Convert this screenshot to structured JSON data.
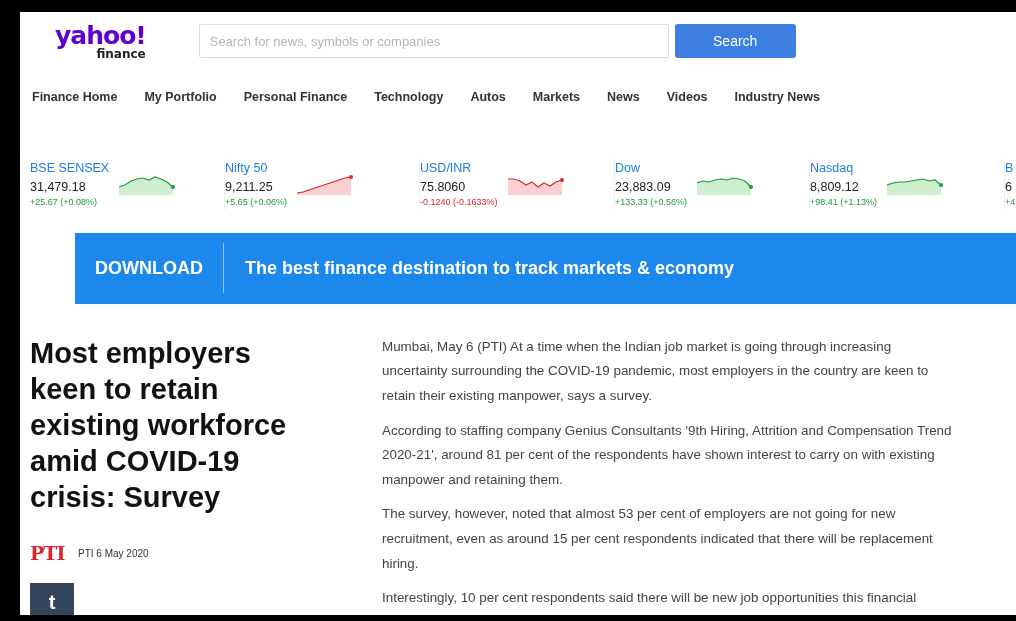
{
  "header": {
    "logo": {
      "brand": "yahoo!",
      "sub": "finance"
    },
    "search": {
      "placeholder": "Search for news, symbols or companies"
    },
    "search_button": "Search"
  },
  "nav": [
    "Finance Home",
    "My Portfolio",
    "Personal Finance",
    "Technology",
    "Autos",
    "Markets",
    "News",
    "Videos",
    "Industry News"
  ],
  "tickers": [
    {
      "name": "BSE SENSEX",
      "value": "31,479.18",
      "change": "+25.67 (+0.08%)",
      "falling": false,
      "chart_falling": false
    },
    {
      "name": "Nifty 50",
      "value": "9,211.25",
      "change": "+5.65 (+0.06%)",
      "falling": false,
      "chart_falling": true
    },
    {
      "name": "USD/INR",
      "value": "75.8060",
      "change": "-0.1240 (-0.1633%)",
      "falling": true,
      "chart_falling": true
    },
    {
      "name": "Dow",
      "value": "23,883.09",
      "change": "+133.33 (+0.56%)",
      "falling": false,
      "chart_falling": false
    },
    {
      "name": "Nasdaq",
      "value": "8,809.12",
      "change": "+98.41 (+1.13%)",
      "falling": false,
      "chart_falling": false
    },
    {
      "name": "B",
      "value": "6",
      "change": "+4",
      "falling": false
    }
  ],
  "banner": {
    "label": "DOWNLOAD",
    "text": "The best finance destination to track markets & economy"
  },
  "article": {
    "headline": "Most employers keen to retain existing workforce amid COVID-19 crisis: Survey",
    "source_logo": "PTI",
    "byline": "PTI 6 May 2020",
    "share_button": "t",
    "paragraphs": [
      "Mumbai, May 6 (PTI) At a time when the Indian job market is going through increasing uncertainty surrounding the COVID-19 pandemic, most employers in the country are keen to retain their existing manpower, says a survey.",
      "According to staffing company Genius Consultants '9th Hiring, Attrition and Compensation Trend 2020-21', around 81 per cent of the respondents have shown interest to carry on with existing manpower and retaining them.",
      "The survey, however, noted that almost 53 per cent of employers are not going for new recruitment, even as around 15 per cent respondents indicated that there will be replacement hiring.",
      "Interestingly, 10 per cent respondents said there will be new job opportunities this financial"
    ]
  }
}
